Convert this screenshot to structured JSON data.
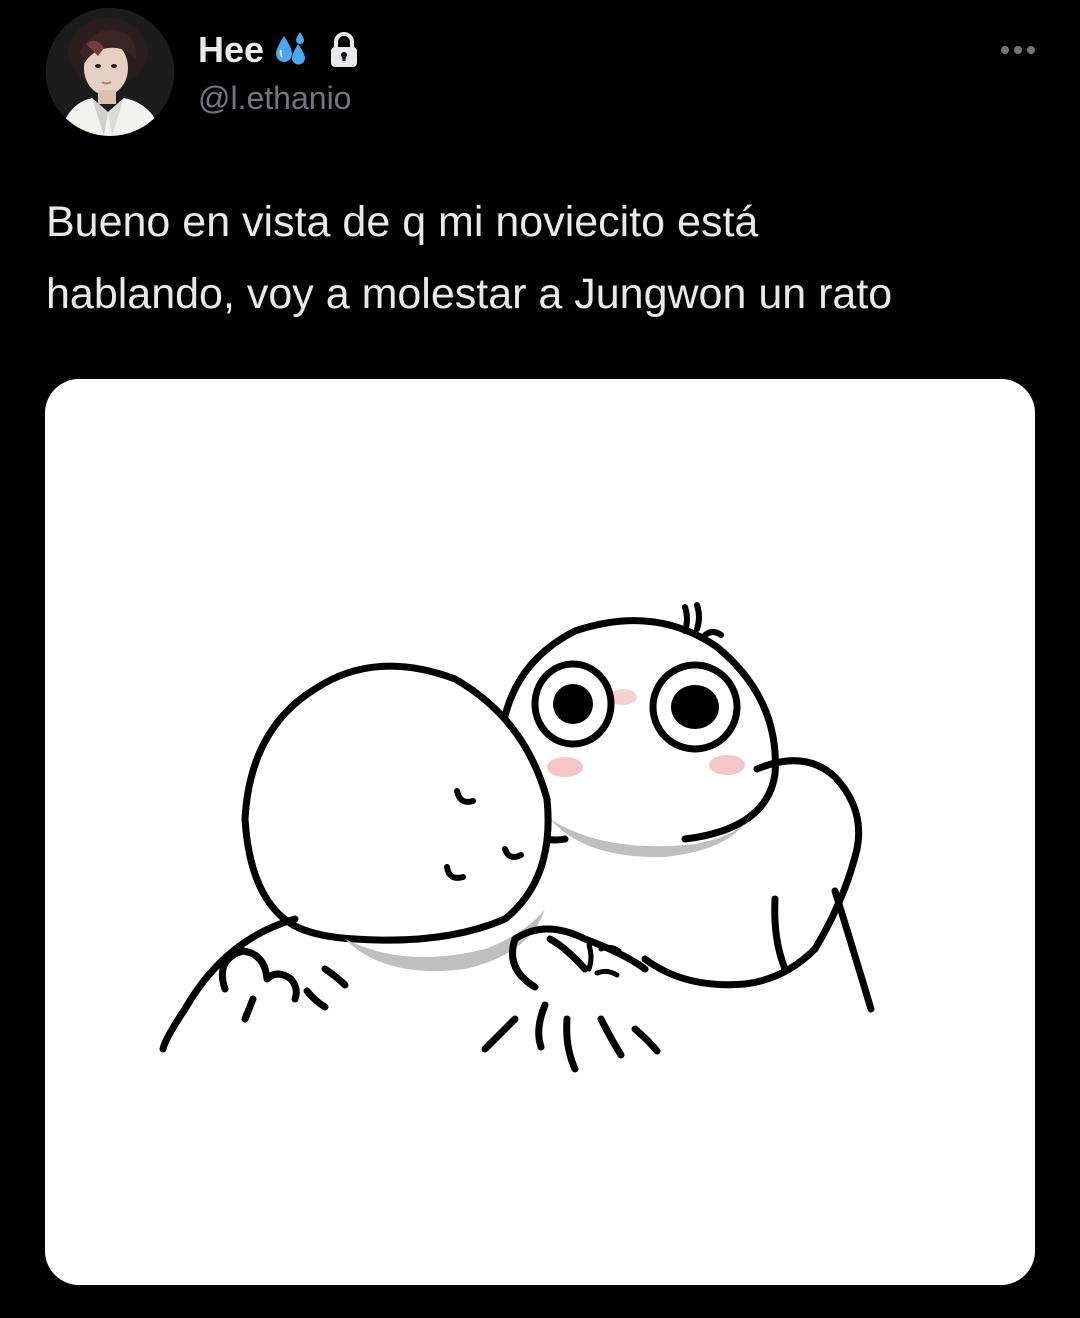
{
  "tweet": {
    "author": {
      "display_name": "Hee",
      "handle": "@l.ethanio",
      "badges": [
        "sweat-droplets-emoji-icon",
        "lock-icon"
      ]
    },
    "text": "Bueno en vista de q mi noviecito está\nhablando, voy a molestar a Jungwon un rato",
    "menu_icon": "more-horizontal-icon",
    "media": {
      "type": "illustration",
      "background": "#ffffff"
    }
  },
  "colors": {
    "background": "#000000",
    "text_primary": "#e7e9ea",
    "text_secondary": "#71767b",
    "emoji_blue": "#4aa8f0"
  }
}
